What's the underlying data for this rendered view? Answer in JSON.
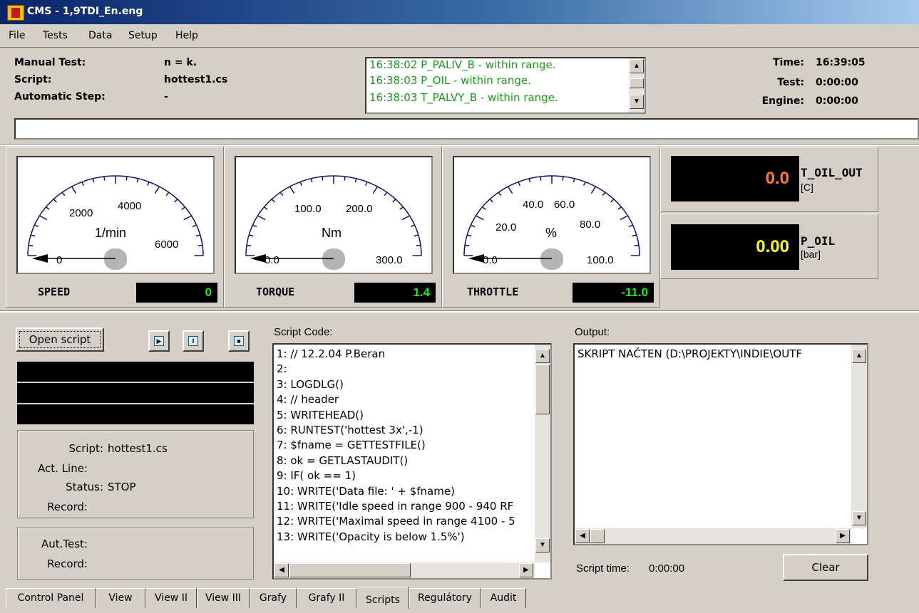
{
  "window": {
    "title": "CMS - 1,9TDI_En.eng"
  },
  "menu": [
    {
      "label": "File"
    },
    {
      "label": "Tests"
    },
    {
      "label": "Data"
    },
    {
      "label": "Setup"
    },
    {
      "label": "Help"
    }
  ],
  "header": {
    "manual_test_label": "Manual Test:",
    "manual_test_value": "n = k.",
    "script_label": "Script:",
    "script_value": "hottest1.cs",
    "auto_step_label": "Automatic Step:",
    "auto_step_value": "-",
    "log": [
      "16:38:02 P_PALIV_B - within range.",
      "16:38:03 P_OIL - within range.",
      "16:38:03 T_PALVY_B - within range."
    ],
    "time_label": "Time:",
    "time_value": "16:39:05",
    "test_label": "Test:",
    "test_value": "0:00:00",
    "engine_label": "Engine:",
    "engine_value": "0:00:00"
  },
  "gauges": {
    "speed": {
      "name": "SPEED",
      "unit": "1/min",
      "ticks": [
        "0",
        "2000",
        "4000",
        "6000"
      ],
      "value": "0"
    },
    "torque": {
      "name": "TORQUE",
      "unit": "Nm",
      "ticks": [
        "0.0",
        "100.0",
        "200.0",
        "300.0"
      ],
      "value": "1.4"
    },
    "throttle": {
      "name": "THROTTLE",
      "unit": "%",
      "ticks": [
        "0.0",
        "20.0",
        "40.0",
        "60.0",
        "80.0",
        "100.0"
      ],
      "value": "-11.0"
    }
  },
  "displays": {
    "t_oil_out": {
      "name": "T_OIL_OUT",
      "unit": "[C]",
      "value": "0.0",
      "color": "#ff7a2a"
    },
    "p_oil": {
      "name": "P_OIL",
      "unit": "[bar]",
      "value": "0.00",
      "color": "#ffff00"
    }
  },
  "scripts": {
    "open_button": "Open script",
    "info": {
      "script_label": "Script:",
      "script_value": "hottest1.cs",
      "act_line_label": "Act. Line:",
      "status_label": "Status:",
      "status_value": "STOP",
      "record_label": "Record:"
    },
    "auto": {
      "aut_test_label": "Aut.Test:",
      "record_label": "Record:"
    },
    "code_label": "Script Code:",
    "code": [
      "1: // 12.2.04 P.Beran",
      "2:",
      "3: LOGDLG()",
      "4: // header",
      "5: WRITEHEAD()",
      "6: RUNTEST('hottest 3x',-1)",
      "7: $fname = GETTESTFILE()",
      "8: ok = GETLASTAUDIT()",
      "9: IF( ok == 1)",
      "10:   WRITE('Data file: ' + $fname)",
      "11:   WRITE('Idle speed in range 900 - 940 RF",
      "12:   WRITE('Maximal speed in range 4100 - 5",
      "13:   WRITE('Opacity is below 1.5%')"
    ],
    "output_label": "Output:",
    "output": [
      "SKRIPT NAČTEN (D:\\PROJEKTY\\INDIE\\OUTF"
    ],
    "script_time_label": "Script time:",
    "script_time_value": "0:00:00",
    "clear_button": "Clear"
  },
  "tabs": [
    {
      "label": "Control Panel"
    },
    {
      "label": "View"
    },
    {
      "label": "View II"
    },
    {
      "label": "View III"
    },
    {
      "label": "Grafy"
    },
    {
      "label": "Grafy II"
    },
    {
      "label": "Scripts",
      "selected": true
    },
    {
      "label": "Regulátory"
    },
    {
      "label": "Audit"
    }
  ],
  "gauge_needles": {
    "speed": 0.0,
    "torque": 0.0,
    "throttle": 0.0
  }
}
